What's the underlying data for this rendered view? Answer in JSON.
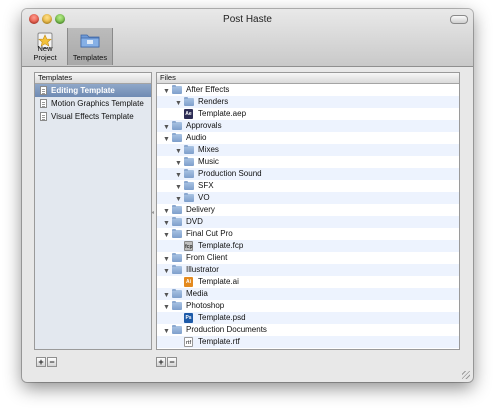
{
  "window": {
    "title": "Post Haste"
  },
  "toolbar": {
    "new_project_label": "New Project",
    "templates_label": "Templates",
    "selected": "Templates"
  },
  "templates_panel": {
    "header": "Templates",
    "items": [
      {
        "label": "Editing Template",
        "selected": true
      },
      {
        "label": "Motion Graphics Template",
        "selected": false
      },
      {
        "label": "Visual Effects Template",
        "selected": false
      }
    ],
    "add_label": "+",
    "remove_label": "−"
  },
  "files_panel": {
    "header": "Files",
    "rows": [
      {
        "type": "folder",
        "level": 0,
        "label": "After Effects"
      },
      {
        "type": "folder",
        "level": 1,
        "label": "Renders"
      },
      {
        "type": "file",
        "level": 1,
        "label": "Template.aep",
        "icon": "aep"
      },
      {
        "type": "folder",
        "level": 0,
        "label": "Approvals"
      },
      {
        "type": "folder",
        "level": 0,
        "label": "Audio"
      },
      {
        "type": "folder",
        "level": 1,
        "label": "Mixes"
      },
      {
        "type": "folder",
        "level": 1,
        "label": "Music"
      },
      {
        "type": "folder",
        "level": 1,
        "label": "Production Sound"
      },
      {
        "type": "folder",
        "level": 1,
        "label": "SFX"
      },
      {
        "type": "folder",
        "level": 1,
        "label": "VO"
      },
      {
        "type": "folder",
        "level": 0,
        "label": "Delivery"
      },
      {
        "type": "folder",
        "level": 0,
        "label": "DVD"
      },
      {
        "type": "folder",
        "level": 0,
        "label": "Final Cut Pro"
      },
      {
        "type": "file",
        "level": 1,
        "label": "Template.fcp",
        "icon": "fcp"
      },
      {
        "type": "folder",
        "level": 0,
        "label": "From Client"
      },
      {
        "type": "folder",
        "level": 0,
        "label": "Illustrator"
      },
      {
        "type": "file",
        "level": 1,
        "label": "Template.ai",
        "icon": "ai"
      },
      {
        "type": "folder",
        "level": 0,
        "label": "Media"
      },
      {
        "type": "folder",
        "level": 0,
        "label": "Photoshop"
      },
      {
        "type": "file",
        "level": 1,
        "label": "Template.psd",
        "icon": "psd"
      },
      {
        "type": "folder",
        "level": 0,
        "label": "Production Documents"
      },
      {
        "type": "file",
        "level": 1,
        "label": "Template.rtf",
        "icon": "rtf"
      }
    ],
    "add_label": "+",
    "remove_label": "−"
  },
  "colors": {
    "selection": "#7d97bd",
    "alt_row": "#edf3fe",
    "folder": "#8ea9cf"
  }
}
